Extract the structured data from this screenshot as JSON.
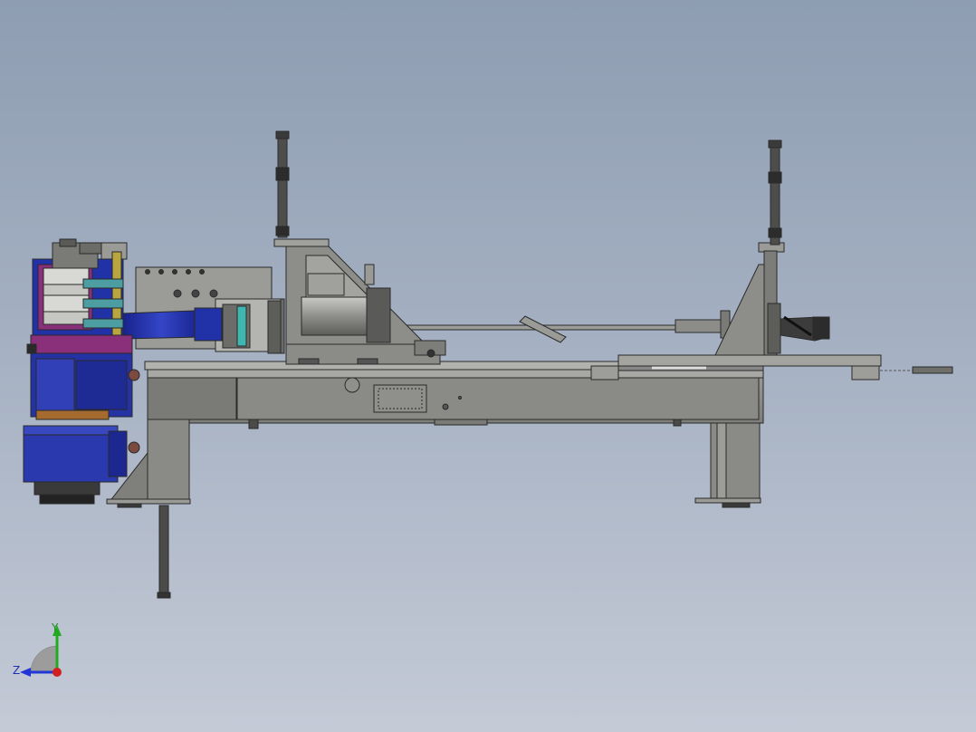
{
  "viewport": {
    "background_top": "#8e9db2",
    "background_bottom": "#c4cad6"
  },
  "model": {
    "colors": {
      "frame": "#8a8a87",
      "frame_dark": "#6e6e6b",
      "frame_light": "#a7a7a3",
      "outline": "#2a2a2a",
      "bend_head_blue": "#1f2fa8",
      "motor_blue": "#2432a4",
      "accent_magenta": "#8a2f7a",
      "accent_yellow": "#b9a640",
      "accent_teal": "#3fb6b0",
      "accent_bronze": "#a46a2e"
    }
  },
  "triad": {
    "y_label": "Y",
    "z_label": "Z",
    "y_color": "#1faa1f",
    "z_color": "#2236d6",
    "x_color": "#d21f1f"
  }
}
